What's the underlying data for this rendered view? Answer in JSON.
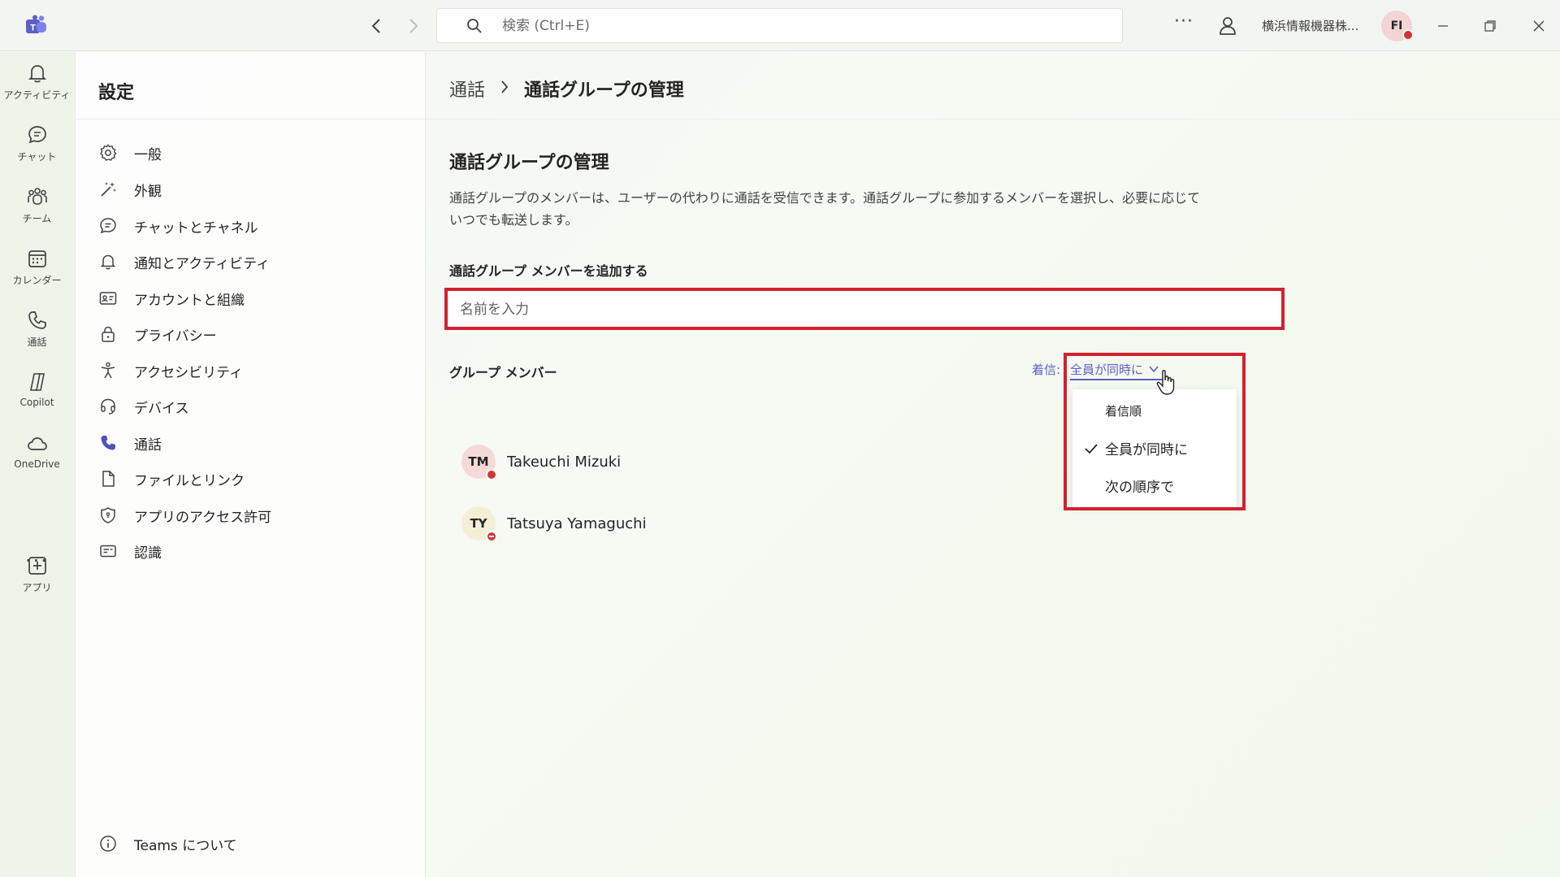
{
  "titlebar": {
    "search_placeholder": "検索 (Ctrl+E)",
    "more": "···",
    "org_name": "横浜情報機器株...",
    "avatar_initials": "FI"
  },
  "rail": {
    "items": [
      {
        "label": "アクティビティ",
        "icon": "bell-icon"
      },
      {
        "label": "チャット",
        "icon": "chat-icon"
      },
      {
        "label": "チーム",
        "icon": "teams-icon"
      },
      {
        "label": "カレンダー",
        "icon": "calendar-icon"
      },
      {
        "label": "通話",
        "icon": "phone-icon"
      },
      {
        "label": "Copilot",
        "icon": "copilot-icon"
      },
      {
        "label": "OneDrive",
        "icon": "cloud-icon"
      }
    ],
    "more": "···",
    "apps_label": "アプリ"
  },
  "settings": {
    "title": "設定",
    "items": [
      {
        "label": "一般",
        "icon": "gear-icon"
      },
      {
        "label": "外観",
        "icon": "wand-icon"
      },
      {
        "label": "チャットとチャネル",
        "icon": "chat-icon"
      },
      {
        "label": "通知とアクティビティ",
        "icon": "bell-icon"
      },
      {
        "label": "アカウントと組織",
        "icon": "id-card-icon"
      },
      {
        "label": "プライバシー",
        "icon": "lock-icon"
      },
      {
        "label": "アクセシビリティ",
        "icon": "accessibility-icon"
      },
      {
        "label": "デバイス",
        "icon": "headset-icon"
      },
      {
        "label": "通話",
        "icon": "phone-icon"
      },
      {
        "label": "ファイルとリンク",
        "icon": "file-icon"
      },
      {
        "label": "アプリのアクセス許可",
        "icon": "shield-icon"
      },
      {
        "label": "認識",
        "icon": "captions-icon"
      }
    ],
    "about": "Teams について"
  },
  "main": {
    "breadcrumb_parent": "通話",
    "breadcrumb_current": "通話グループの管理",
    "section_title": "通話グループの管理",
    "description": "通話グループのメンバーは、ユーザーの代わりに通話を受信できます。通話グループに参加するメンバーを選択し、必要に応じていつでも転送します。",
    "add_label": "通話グループ メンバーを追加する",
    "name_placeholder": "名前を入力",
    "members_label": "グループ メンバー",
    "ringing_label": "着信:",
    "ringing_value": "全員が同時に",
    "members": [
      {
        "initials": "TM",
        "name": "Takeuchi Mizuki",
        "avatar_color": "#f6dad7",
        "status": "busy"
      },
      {
        "initials": "TY",
        "name": "Tatsuya Yamaguchi",
        "avatar_color": "#f5efd6",
        "status": "dnd"
      }
    ]
  },
  "dropdown": {
    "options": [
      {
        "label": "着信順",
        "selected": false
      },
      {
        "label": "全員が同時に",
        "selected": true
      },
      {
        "label": "次の順序で",
        "selected": false
      }
    ]
  },
  "colors": {
    "accent": "#5b5fc7",
    "highlight_box": "#d4202f",
    "status_red": "#d13438"
  }
}
